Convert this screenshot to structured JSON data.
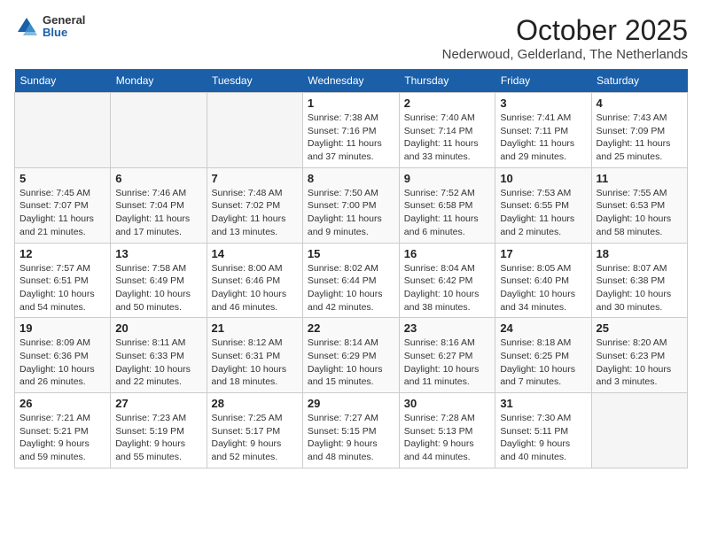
{
  "logo": {
    "general": "General",
    "blue": "Blue"
  },
  "title": "October 2025",
  "subtitle": "Nederwoud, Gelderland, The Netherlands",
  "days_of_week": [
    "Sunday",
    "Monday",
    "Tuesday",
    "Wednesday",
    "Thursday",
    "Friday",
    "Saturday"
  ],
  "weeks": [
    {
      "days": [
        {
          "number": "",
          "info": ""
        },
        {
          "number": "",
          "info": ""
        },
        {
          "number": "",
          "info": ""
        },
        {
          "number": "1",
          "info": "Sunrise: 7:38 AM\nSunset: 7:16 PM\nDaylight: 11 hours\nand 37 minutes."
        },
        {
          "number": "2",
          "info": "Sunrise: 7:40 AM\nSunset: 7:14 PM\nDaylight: 11 hours\nand 33 minutes."
        },
        {
          "number": "3",
          "info": "Sunrise: 7:41 AM\nSunset: 7:11 PM\nDaylight: 11 hours\nand 29 minutes."
        },
        {
          "number": "4",
          "info": "Sunrise: 7:43 AM\nSunset: 7:09 PM\nDaylight: 11 hours\nand 25 minutes."
        }
      ]
    },
    {
      "days": [
        {
          "number": "5",
          "info": "Sunrise: 7:45 AM\nSunset: 7:07 PM\nDaylight: 11 hours\nand 21 minutes."
        },
        {
          "number": "6",
          "info": "Sunrise: 7:46 AM\nSunset: 7:04 PM\nDaylight: 11 hours\nand 17 minutes."
        },
        {
          "number": "7",
          "info": "Sunrise: 7:48 AM\nSunset: 7:02 PM\nDaylight: 11 hours\nand 13 minutes."
        },
        {
          "number": "8",
          "info": "Sunrise: 7:50 AM\nSunset: 7:00 PM\nDaylight: 11 hours\nand 9 minutes."
        },
        {
          "number": "9",
          "info": "Sunrise: 7:52 AM\nSunset: 6:58 PM\nDaylight: 11 hours\nand 6 minutes."
        },
        {
          "number": "10",
          "info": "Sunrise: 7:53 AM\nSunset: 6:55 PM\nDaylight: 11 hours\nand 2 minutes."
        },
        {
          "number": "11",
          "info": "Sunrise: 7:55 AM\nSunset: 6:53 PM\nDaylight: 10 hours\nand 58 minutes."
        }
      ]
    },
    {
      "days": [
        {
          "number": "12",
          "info": "Sunrise: 7:57 AM\nSunset: 6:51 PM\nDaylight: 10 hours\nand 54 minutes."
        },
        {
          "number": "13",
          "info": "Sunrise: 7:58 AM\nSunset: 6:49 PM\nDaylight: 10 hours\nand 50 minutes."
        },
        {
          "number": "14",
          "info": "Sunrise: 8:00 AM\nSunset: 6:46 PM\nDaylight: 10 hours\nand 46 minutes."
        },
        {
          "number": "15",
          "info": "Sunrise: 8:02 AM\nSunset: 6:44 PM\nDaylight: 10 hours\nand 42 minutes."
        },
        {
          "number": "16",
          "info": "Sunrise: 8:04 AM\nSunset: 6:42 PM\nDaylight: 10 hours\nand 38 minutes."
        },
        {
          "number": "17",
          "info": "Sunrise: 8:05 AM\nSunset: 6:40 PM\nDaylight: 10 hours\nand 34 minutes."
        },
        {
          "number": "18",
          "info": "Sunrise: 8:07 AM\nSunset: 6:38 PM\nDaylight: 10 hours\nand 30 minutes."
        }
      ]
    },
    {
      "days": [
        {
          "number": "19",
          "info": "Sunrise: 8:09 AM\nSunset: 6:36 PM\nDaylight: 10 hours\nand 26 minutes."
        },
        {
          "number": "20",
          "info": "Sunrise: 8:11 AM\nSunset: 6:33 PM\nDaylight: 10 hours\nand 22 minutes."
        },
        {
          "number": "21",
          "info": "Sunrise: 8:12 AM\nSunset: 6:31 PM\nDaylight: 10 hours\nand 18 minutes."
        },
        {
          "number": "22",
          "info": "Sunrise: 8:14 AM\nSunset: 6:29 PM\nDaylight: 10 hours\nand 15 minutes."
        },
        {
          "number": "23",
          "info": "Sunrise: 8:16 AM\nSunset: 6:27 PM\nDaylight: 10 hours\nand 11 minutes."
        },
        {
          "number": "24",
          "info": "Sunrise: 8:18 AM\nSunset: 6:25 PM\nDaylight: 10 hours\nand 7 minutes."
        },
        {
          "number": "25",
          "info": "Sunrise: 8:20 AM\nSunset: 6:23 PM\nDaylight: 10 hours\nand 3 minutes."
        }
      ]
    },
    {
      "days": [
        {
          "number": "26",
          "info": "Sunrise: 7:21 AM\nSunset: 5:21 PM\nDaylight: 9 hours\nand 59 minutes."
        },
        {
          "number": "27",
          "info": "Sunrise: 7:23 AM\nSunset: 5:19 PM\nDaylight: 9 hours\nand 55 minutes."
        },
        {
          "number": "28",
          "info": "Sunrise: 7:25 AM\nSunset: 5:17 PM\nDaylight: 9 hours\nand 52 minutes."
        },
        {
          "number": "29",
          "info": "Sunrise: 7:27 AM\nSunset: 5:15 PM\nDaylight: 9 hours\nand 48 minutes."
        },
        {
          "number": "30",
          "info": "Sunrise: 7:28 AM\nSunset: 5:13 PM\nDaylight: 9 hours\nand 44 minutes."
        },
        {
          "number": "31",
          "info": "Sunrise: 7:30 AM\nSunset: 5:11 PM\nDaylight: 9 hours\nand 40 minutes."
        },
        {
          "number": "",
          "info": ""
        }
      ]
    }
  ]
}
